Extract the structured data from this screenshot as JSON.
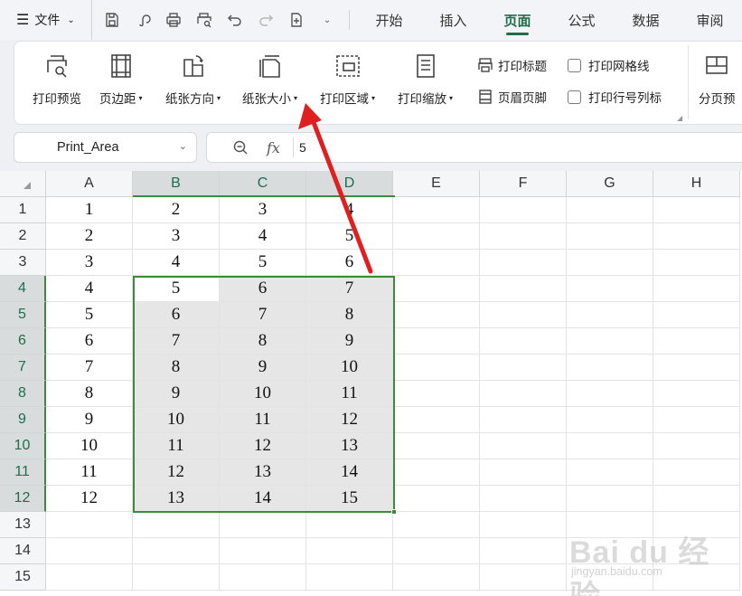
{
  "menubar": {
    "file_label": "文件",
    "hamburger_glyph": "☰",
    "tabs": [
      {
        "label": "开始",
        "active": false
      },
      {
        "label": "插入",
        "active": false
      },
      {
        "label": "页面",
        "active": true
      },
      {
        "label": "公式",
        "active": false
      },
      {
        "label": "数据",
        "active": false
      },
      {
        "label": "审阅",
        "active": false
      }
    ]
  },
  "ribbon": {
    "print_preview": "打印预览",
    "margins": "页边距",
    "orientation": "纸张方向",
    "paper_size": "纸张大小",
    "print_area": "打印区域",
    "print_scale": "打印缩放",
    "print_titles": "打印标题",
    "header_footer": "页眉页脚",
    "print_gridlines": "打印网格线",
    "print_row_col_headers": "打印行号列标",
    "page_break_preview": "分页预",
    "dropdown_glyph": "▾"
  },
  "formula_bar": {
    "name_box": "Print_Area",
    "fx_label": "fx",
    "value": "5"
  },
  "grid": {
    "columns": [
      "A",
      "B",
      "C",
      "D",
      "E",
      "F",
      "G",
      "H"
    ],
    "selected_columns": [
      "B",
      "C",
      "D"
    ],
    "rows": [
      1,
      2,
      3,
      4,
      5,
      6,
      7,
      8,
      9,
      10,
      11,
      12,
      13,
      14,
      15
    ],
    "selected_rows": [
      4,
      5,
      6,
      7,
      8,
      9,
      10,
      11,
      12
    ],
    "cells": [
      [
        1,
        2,
        3,
        4
      ],
      [
        2,
        3,
        4,
        5
      ],
      [
        3,
        4,
        5,
        6
      ],
      [
        4,
        5,
        6,
        7
      ],
      [
        5,
        6,
        7,
        8
      ],
      [
        6,
        7,
        8,
        9
      ],
      [
        7,
        8,
        9,
        10
      ],
      [
        8,
        9,
        10,
        11
      ],
      [
        9,
        10,
        11,
        12
      ],
      [
        10,
        11,
        12,
        13
      ],
      [
        11,
        12,
        13,
        14
      ],
      [
        12,
        13,
        14,
        15
      ]
    ],
    "selection": "B4:D12",
    "active_cell": "B4"
  },
  "annotation": {
    "arrow_color": "#e02020"
  },
  "watermark": {
    "logo_text": "Bai du 经验",
    "url_text": "jingyan.baidu.com"
  }
}
